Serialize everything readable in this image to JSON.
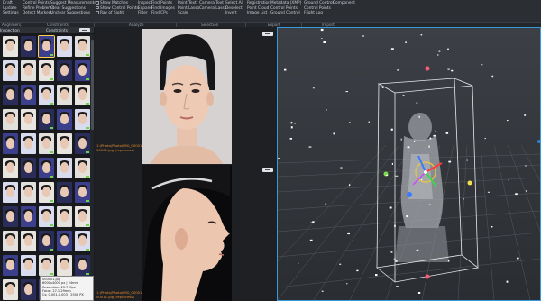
{
  "ribbon": {
    "col1": [
      "Draft",
      "Update",
      "Settings"
    ],
    "col2": [
      "Control Points",
      "Refine Problems",
      "Detect Markers"
    ],
    "col3": [
      "Suggest Measurements",
      "Clear Suggestions",
      "Unclear Suggestions"
    ],
    "col4": [
      "Show Matches",
      "Show Control Points",
      "Ray of Sight"
    ],
    "col5": [
      "Inspect",
      "Expand",
      "Filter"
    ],
    "col6": [
      "Find Points",
      "Find Images",
      "Find CPs"
    ],
    "col7": [
      "Point Text",
      "Point Lasso",
      "Scale"
    ],
    "col8": [
      "Camera Text",
      "Camera Lasso",
      ""
    ],
    "col9": [
      "Select All",
      "Deselect",
      "Invert"
    ],
    "col10": [
      "Registration",
      "Point Cloud",
      "Image List"
    ],
    "col11": [
      "Metadata (XMP)",
      "Control Points",
      "Ground Control"
    ],
    "col12": [
      "Ground Control",
      "Control Points",
      "Flight Log"
    ],
    "col13": [
      "Component",
      "",
      ""
    ],
    "groups": [
      "Alignment",
      "Constraints",
      "Analyze",
      "Selection",
      "Export",
      "Import"
    ]
  },
  "left_panel": {
    "tab_left": "Inspection",
    "tab_right": "Constraints",
    "tooltip": [
      "000001.jpg",
      "6000x4000 px | 24mm",
      "Resolution: 23.7 Mpx",
      "Focal: 27.1-29mm",
      "Cs: 0.001-0.003 | 2506 PX"
    ]
  },
  "middle_panel": {
    "caption_a1": "1:\\Photo\\Photo\\IMG_00001",
    "caption_a2": "00001.jpg (reprocess)",
    "caption_b1": "1:\\Photo\\Photo\\IMG_00001",
    "caption_b2": "00011.jpg (reprocess)"
  },
  "colors": {
    "accent": "#3a9ad9",
    "caption": "#e58a2e",
    "thumb_mark": "#67d44a",
    "gizmo_x": "#ff3a3a",
    "gizmo_y": "#3ad84a",
    "gizmo_z": "#3a7aff"
  },
  "icons": [
    "checkbox-icon",
    "panel-toggle-icon",
    "transform-gizmo-icon",
    "bounding-box-icon"
  ]
}
